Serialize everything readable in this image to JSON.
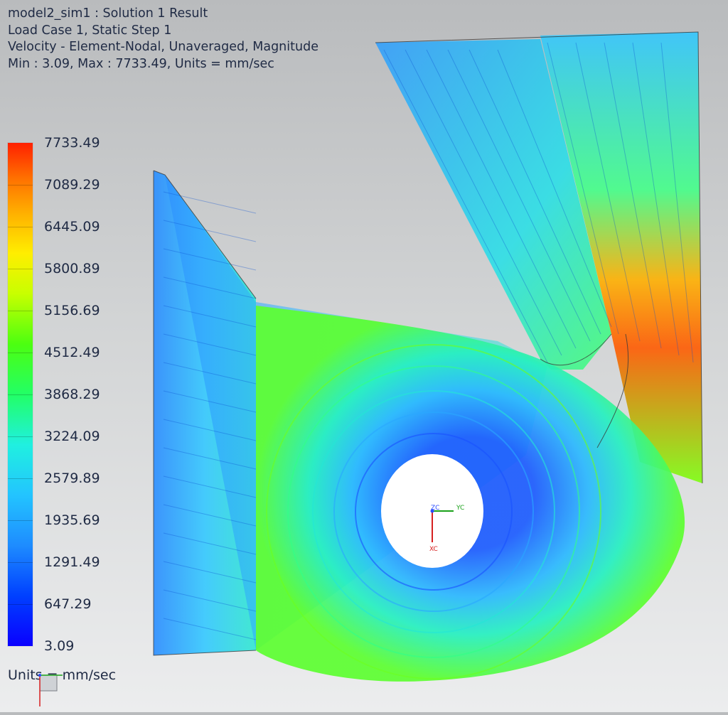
{
  "header": {
    "line1": "model2_sim1 : Solution 1 Result",
    "line2": "Load Case 1, Static Step 1",
    "line3": "Velocity - Element-Nodal, Unaveraged, Magnitude",
    "line4": "Min : 3.09, Max : 7733.49, Units = mm/sec"
  },
  "legend": {
    "labels": [
      "7733.49",
      "7089.29",
      "6445.09",
      "5800.89",
      "5156.69",
      "4512.49",
      "3868.29",
      "3224.09",
      "2579.89",
      "1935.69",
      "1291.49",
      "647.29",
      "3.09"
    ],
    "units": "Units = mm/sec"
  },
  "triad": {
    "x": "XC",
    "y": "YC",
    "z": "ZC"
  },
  "colors": {
    "min": "#0a00ff",
    "mid": "#22ff66",
    "max": "#ff2000",
    "annotation_text": "#1f2a44"
  }
}
